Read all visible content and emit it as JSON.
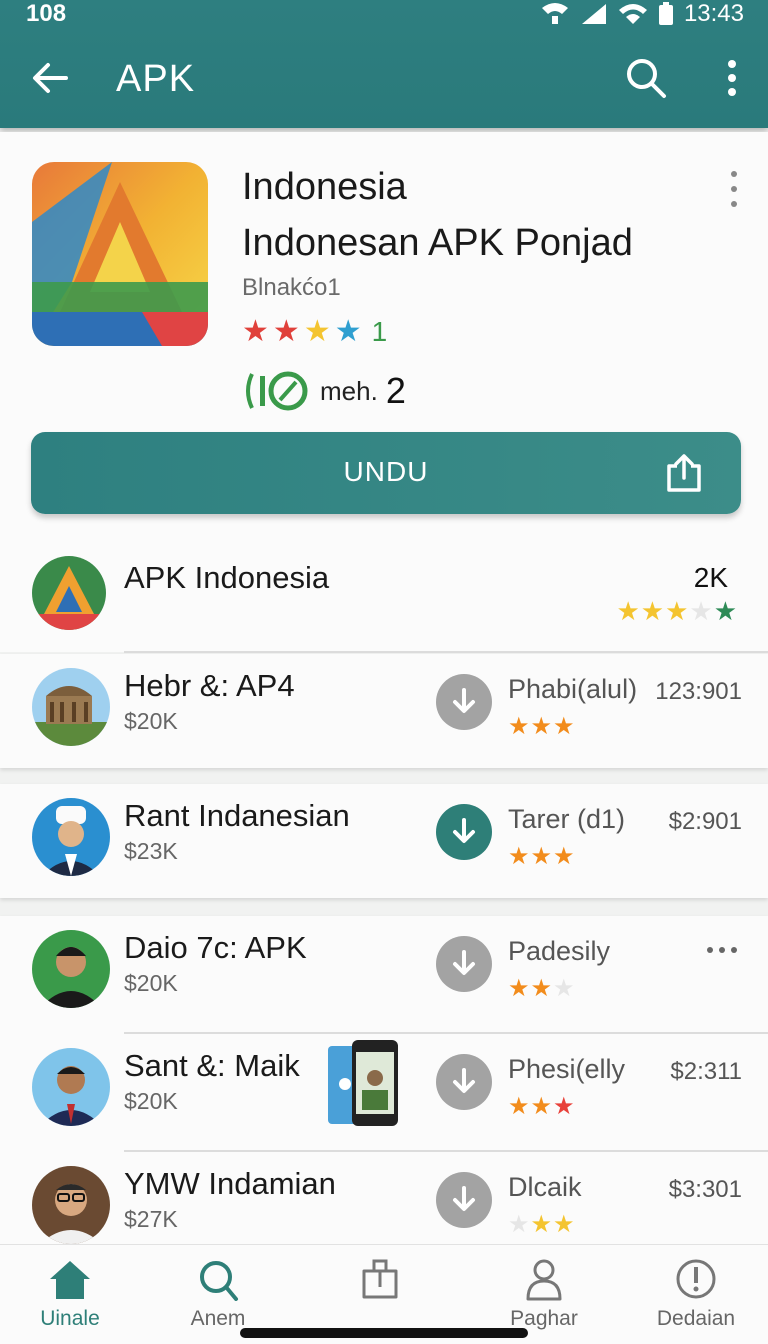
{
  "status": {
    "time_left": "108",
    "clock": "13:43"
  },
  "appbar": {
    "title": "APK"
  },
  "app": {
    "name_line1": "Indonesia",
    "name_line2": "Indonesan APK Ponjad",
    "developer": "Blnakćo1",
    "rating_count": "1",
    "meta_label": "meh.",
    "meta_number": "2",
    "download_label": "UNDU"
  },
  "featured": {
    "title": "APK Indonesia",
    "count": "2K",
    "rating": 3.5
  },
  "rows": [
    {
      "title": "Hebr &: AP4",
      "price": "$20K",
      "category": "Phabi(alul)",
      "number": "123:901",
      "rating": 3,
      "action": "grey"
    },
    {
      "title": "Rant Indanesian",
      "price": "$23K",
      "category": "Tarer (d1)",
      "number": "$2:901",
      "rating": 3,
      "action": "teal"
    },
    {
      "title": "Daio 7c: APK",
      "price": "$20K",
      "category": "Padesily",
      "number": "",
      "rating": 2,
      "action": "grey"
    },
    {
      "title": "Sant &: Maik",
      "price": "$20K",
      "category": "Phesi(elly",
      "number": "$2:311",
      "rating": 3,
      "action": "grey"
    },
    {
      "title": "YMW Indamian",
      "price": "$27K",
      "category": "Dlcaik",
      "number": "$3:301",
      "rating": 2,
      "action": "grey"
    }
  ],
  "nav": [
    {
      "label": "Uinale",
      "icon": "home-icon"
    },
    {
      "label": "Anem",
      "icon": "search-icon"
    },
    {
      "label": "",
      "icon": "apps-icon"
    },
    {
      "label": "Paghar",
      "icon": "person-icon"
    },
    {
      "label": "Dedaian",
      "icon": "info-icon"
    }
  ],
  "colors": {
    "primary": "#2e7f80",
    "star_orange": "#f28c1c",
    "star_gold": "#f4c430",
    "star_green": "#2e8b57",
    "active_nav": "#2e7f78"
  }
}
